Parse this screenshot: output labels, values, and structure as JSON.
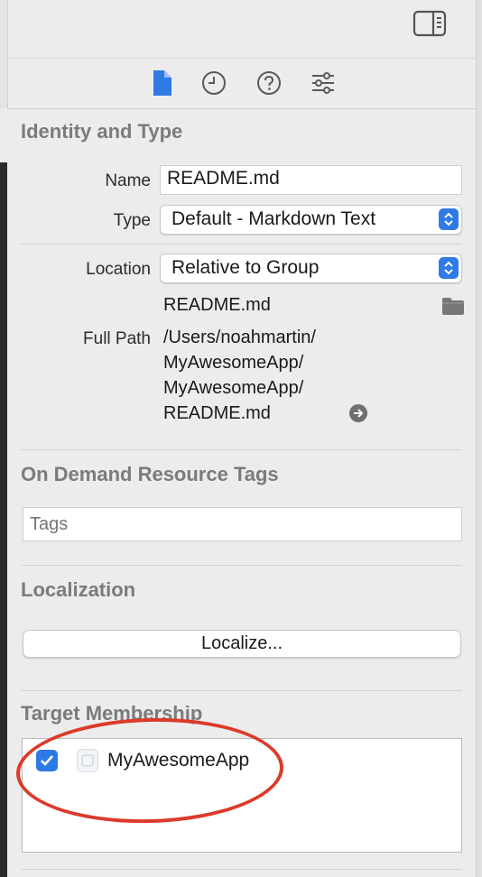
{
  "inspector_tabs": [
    {
      "name": "file-inspector",
      "icon": "document-icon",
      "active": true
    },
    {
      "name": "history-inspector",
      "icon": "clock-icon"
    },
    {
      "name": "quick-help-inspector",
      "icon": "help-icon"
    },
    {
      "name": "attributes-inspector",
      "icon": "sliders-icon"
    }
  ],
  "identity": {
    "title": "Identity and Type",
    "name_label": "Name",
    "name_value": "README.md",
    "type_label": "Type",
    "type_value": "Default - Markdown Text",
    "location_label": "Location",
    "location_value": "Relative to Group",
    "file_name": "README.md",
    "full_path_label": "Full Path",
    "full_path_lines": [
      "/Users/noahmartin/",
      "MyAwesomeApp/",
      "MyAwesomeApp/",
      "README.md"
    ]
  },
  "odr": {
    "title": "On Demand Resource Tags",
    "tags_placeholder": "Tags"
  },
  "localization": {
    "title": "Localization",
    "button_label": "Localize..."
  },
  "target_membership": {
    "title": "Target Membership",
    "targets": [
      {
        "name": "MyAwesomeApp",
        "checked": true
      }
    ]
  },
  "colors": {
    "accent": "#2f7ae5",
    "annotation": "#dc3a2a"
  }
}
